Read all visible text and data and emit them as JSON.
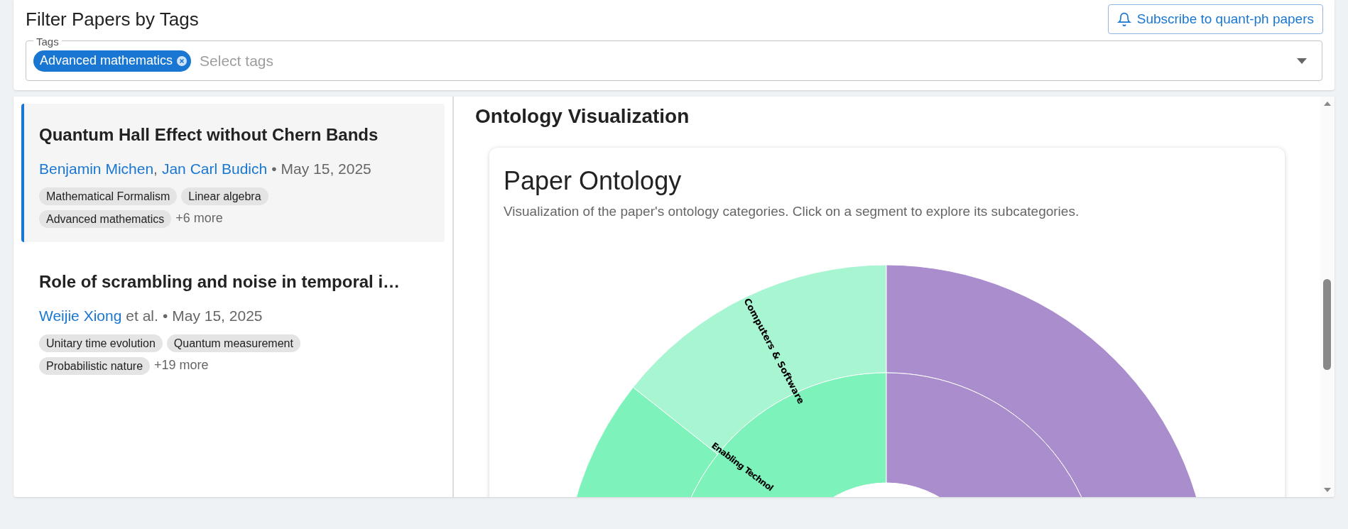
{
  "header": {
    "title": "Filter Papers by Tags",
    "subscribe_button": "Subscribe to quant-ph papers"
  },
  "tag_filter": {
    "label": "Tags",
    "selected_tags": [
      "Advanced mathematics"
    ],
    "placeholder": "Select tags"
  },
  "papers": [
    {
      "title": "Quantum Hall Effect without Chern Bands",
      "authors": [
        {
          "name": "Benjamin Michen",
          "after": ","
        },
        {
          "name": "Jan Carl Budich"
        }
      ],
      "bullet": "•",
      "date": "May 15, 2025",
      "tags": [
        "Mathematical Formalism",
        "Linear algebra",
        "Advanced mathematics"
      ],
      "more": "+6 more",
      "selected": true
    },
    {
      "title": "Role of scrambling and noise in temporal i…",
      "authors": [
        {
          "name": "Weijie Xiong"
        }
      ],
      "authors_suffix": "et al.",
      "bullet": "•",
      "date": "May 15, 2025",
      "tags": [
        "Unitary time evolution",
        "Quantum measurement",
        "Probabilistic nature"
      ],
      "more": "+19 more",
      "selected": false
    }
  ],
  "visualization": {
    "heading": "Ontology Visualization",
    "card_title": "Paper Ontology",
    "description": "Visualization of the paper's ontology categories. Click on a segment to explore its subcategories.",
    "inner_ring": [
      {
        "label": "Enabling Technol",
        "color": "#7ef2bb"
      },
      {
        "color": "#a98dcc"
      }
    ],
    "outer_ring": [
      {
        "color": "#7ef2bb"
      },
      {
        "label": "Computers & Software",
        "color": "#a8f5d2"
      },
      {
        "color": "#a98dcc"
      }
    ]
  }
}
